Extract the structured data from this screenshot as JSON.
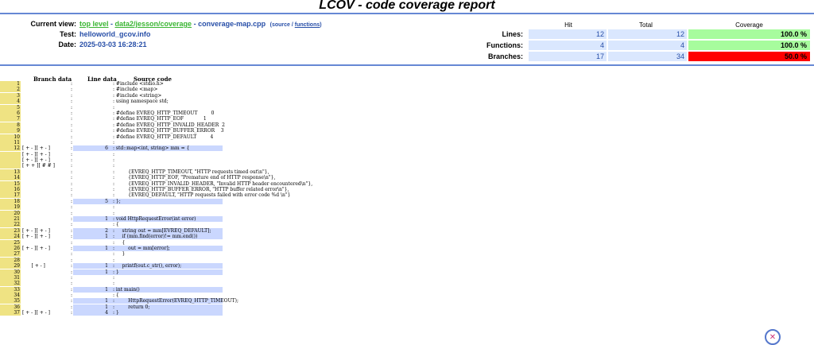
{
  "page": {
    "title": "LCOV - code coverage report"
  },
  "header": {
    "current_view_label": "Current view:",
    "top_level": "top level",
    "separator1": " - ",
    "path": "data2/jesson/coverage",
    "separator2": " - ",
    "file": "converage-map.cpp",
    "source_link": "(source / ",
    "functions_link": "functions",
    "close_paren": ")",
    "test_label": "Test:",
    "test_value": "helloworld_gcov.info",
    "date_label": "Date:",
    "date_value": "2025-03-03 16:28:21"
  },
  "stats": {
    "headers": [
      "Hit",
      "Total",
      "Coverage"
    ],
    "rows": [
      {
        "label": "Lines:",
        "hit": "12",
        "total": "12",
        "coverage": "100.0 %",
        "color": "#a7fc9d"
      },
      {
        "label": "Functions:",
        "hit": "4",
        "total": "4",
        "coverage": "100.0 %",
        "color": "#a7fc9d"
      },
      {
        "label": "Branches:",
        "hit": "17",
        "total": "34",
        "coverage": "50.0 %",
        "color": "#ff0000"
      }
    ]
  },
  "columns": {
    "branch": "Branch data",
    "line": "Line data",
    "source": "Source code"
  },
  "code_lines": [
    {
      "n": "1",
      "br": "",
      "hit": "",
      "src": "#include <stdio.h>",
      "cov": false
    },
    {
      "n": "2",
      "br": "",
      "hit": "",
      "src": "#include <map>",
      "cov": false
    },
    {
      "n": "3",
      "br": "",
      "hit": "",
      "src": "#include <string>",
      "cov": false
    },
    {
      "n": "4",
      "br": "",
      "hit": "",
      "src": "using namespace std;",
      "cov": false
    },
    {
      "n": "5",
      "br": "",
      "hit": "",
      "src": "",
      "cov": false
    },
    {
      "n": "6",
      "br": "",
      "hit": "",
      "src": "#define EVREQ_HTTP_TIMEOUT         0",
      "cov": false
    },
    {
      "n": "7",
      "br": "",
      "hit": "",
      "src": "#define EVREQ_HTTP_EOF             1",
      "cov": false
    },
    {
      "n": "8",
      "br": "",
      "hit": "",
      "src": "#define EVREQ_HTTP_INVALID_HEADER  2",
      "cov": false
    },
    {
      "n": "9",
      "br": "",
      "hit": "",
      "src": "#define EVREQ_HTTP_BUFFER_ERROR    3",
      "cov": false
    },
    {
      "n": "10",
      "br": "",
      "hit": "",
      "src": "#define EVREQ_HTTP_DEFAULT         4",
      "cov": false
    },
    {
      "n": "11",
      "br": "",
      "hit": "",
      "src": "",
      "cov": false
    },
    {
      "n": "12",
      "br": "[ + - ][ + - ]",
      "hit": "6",
      "src": "std::map<int, string> mm = {",
      "cov": true
    },
    {
      "n": "",
      "br": "[ + - ][ + - ]",
      "hit": "",
      "src": "",
      "cov": false
    },
    {
      "n": "",
      "br": "[ + - ][ + - ]",
      "hit": "",
      "src": "",
      "cov": false
    },
    {
      "n": "",
      "br": "[ + + ][ # # ]",
      "hit": "",
      "src": "",
      "cov": false
    },
    {
      "n": "13",
      "br": "",
      "hit": "",
      "src": "        {EVREQ_HTTP_TIMEOUT, \"HTTP requests timed out\\n\"},",
      "cov": false
    },
    {
      "n": "14",
      "br": "",
      "hit": "",
      "src": "        {EVREQ_HTTP_EOF, \"Premature end of HTTP response\\n\"},",
      "cov": false
    },
    {
      "n": "15",
      "br": "",
      "hit": "",
      "src": "        {EVREQ_HTTP_INVALID_HEADER, \"Invalid HTTP header encountered\\n\"},",
      "cov": false
    },
    {
      "n": "16",
      "br": "",
      "hit": "",
      "src": "        {EVREQ_HTTP_BUFFER_ERROR, \"HTTP buffer related error\\n\"},",
      "cov": false
    },
    {
      "n": "17",
      "br": "",
      "hit": "",
      "src": "        {EVREQ_DEFAULT, \"HTTP requests failed with error code %d \\n\"}",
      "cov": false
    },
    {
      "n": "18",
      "br": "",
      "hit": "5",
      "src": "};",
      "cov": true
    },
    {
      "n": "19",
      "br": "",
      "hit": "",
      "src": "",
      "cov": false
    },
    {
      "n": "20",
      "br": "",
      "hit": "",
      "src": "",
      "cov": false
    },
    {
      "n": "21",
      "br": "",
      "hit": "1",
      "src": "void HttpRequestError(int error)",
      "cov": true
    },
    {
      "n": "22",
      "br": "",
      "hit": "",
      "src": "{",
      "cov": false
    },
    {
      "n": "23",
      "br": "[ + - ][ + - ]",
      "hit": "2",
      "src": "    string out = mm[EVREQ_DEFAULT];",
      "cov": true
    },
    {
      "n": "24",
      "br": "[ + - ][ + - ]",
      "hit": "1",
      "src": "    if (mm.find(error)!= mm.end())",
      "cov": true
    },
    {
      "n": "25",
      "br": "",
      "hit": "",
      "src": "    {",
      "cov": false
    },
    {
      "n": "26",
      "br": "[ + - ][ + - ]",
      "hit": "1",
      "src": "        out = mm[error];",
      "cov": true
    },
    {
      "n": "27",
      "br": "",
      "hit": "",
      "src": "    }",
      "cov": false
    },
    {
      "n": "28",
      "br": "",
      "hit": "",
      "src": "",
      "cov": false
    },
    {
      "n": "29",
      "br": "      [ + - ]",
      "hit": "1",
      "src": "    printf(out.c_str(), error);",
      "cov": true
    },
    {
      "n": "30",
      "br": "",
      "hit": "1",
      "src": "}",
      "cov": true
    },
    {
      "n": "31",
      "br": "",
      "hit": "",
      "src": "",
      "cov": false
    },
    {
      "n": "32",
      "br": "",
      "hit": "",
      "src": "",
      "cov": false
    },
    {
      "n": "33",
      "br": "",
      "hit": "1",
      "src": "int main()",
      "cov": true
    },
    {
      "n": "34",
      "br": "",
      "hit": "",
      "src": "{",
      "cov": false
    },
    {
      "n": "35",
      "br": "",
      "hit": "1",
      "src": "        HttpRequestError(EVREQ_HTTP_TIMEOUT);",
      "cov": true
    },
    {
      "n": "36",
      "br": "",
      "hit": "1",
      "src": "        return 0;",
      "cov": true
    },
    {
      "n": "37",
      "br": "[ + - ][ + - ]",
      "hit": "4",
      "src": "}",
      "cov": true
    }
  ],
  "icons": {
    "corner": "assistant-icon"
  }
}
